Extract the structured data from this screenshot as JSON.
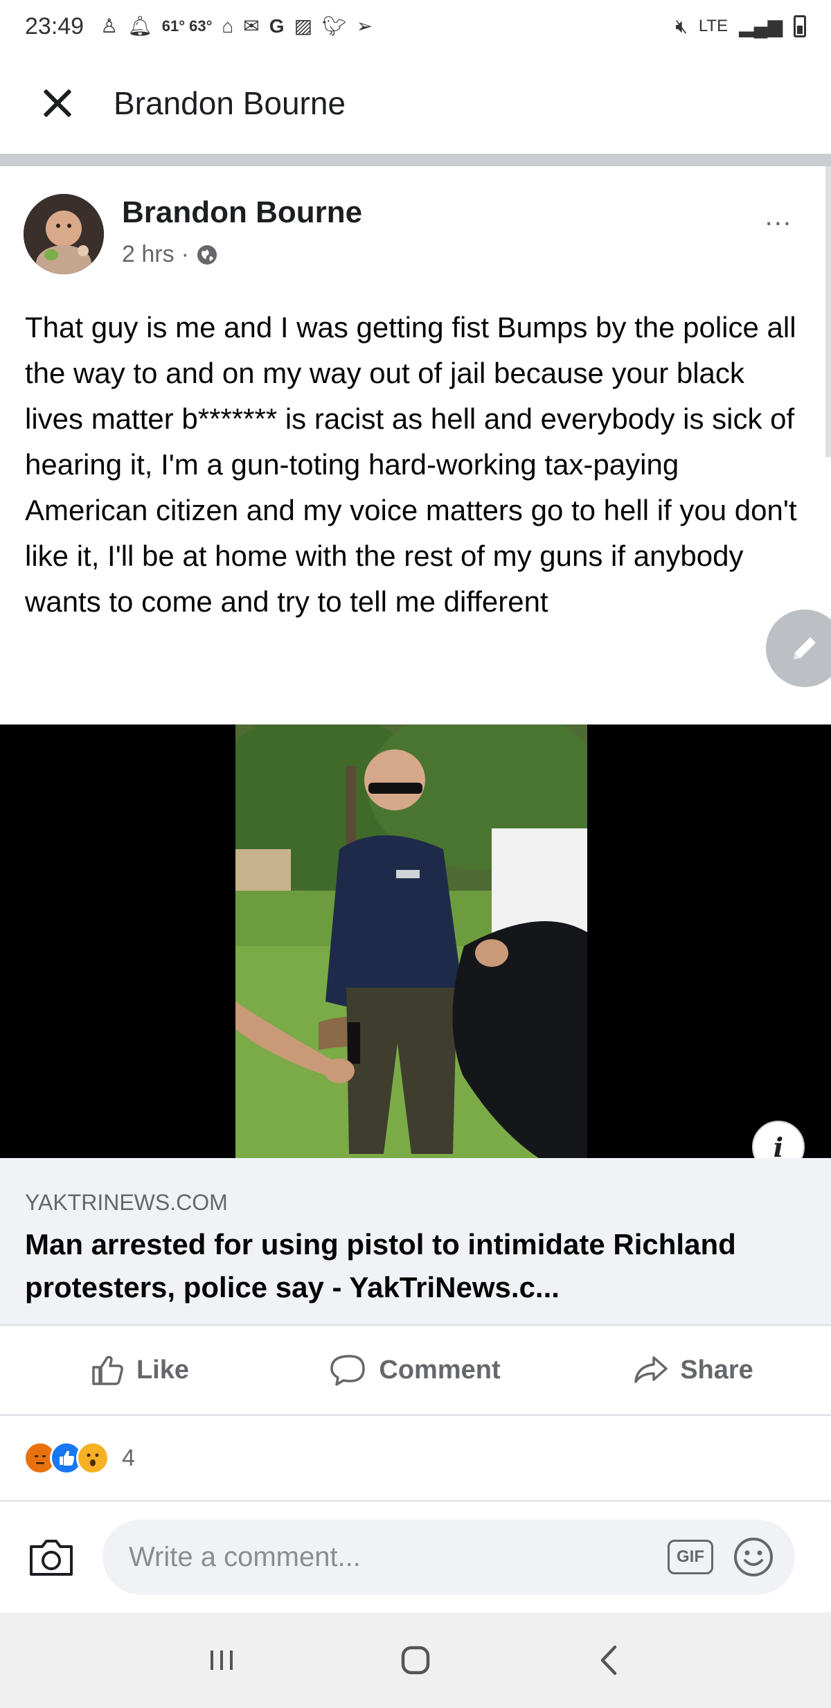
{
  "status_bar": {
    "time": "23:49",
    "temperature": "61° 63°",
    "network": "LTE"
  },
  "header": {
    "title": "Brandon Bourne"
  },
  "post": {
    "author": "Brandon Bourne",
    "time_ago": "2 hrs",
    "separator": "·",
    "text": "That guy is me and I was getting fist Bumps by the police all the way to and on my way out of jail because your black lives matter b******* is racist as hell and everybody is sick of hearing it, I'm a gun-toting hard-working tax-paying American citizen and my voice matters go to hell if you don't like it, I'll be at home with the rest of my guns if anybody wants to come and try to tell me different",
    "more_icon": "..."
  },
  "link_preview": {
    "domain": "YAKTRINEWS.COM",
    "title": "Man arrested for using pistol to intimidate Richland protesters, police say - YakTriNews.c..."
  },
  "actions": {
    "like_label": "Like",
    "comment_label": "Comment",
    "share_label": "Share"
  },
  "reactions": {
    "count": "4",
    "types": [
      "angry",
      "like",
      "wow"
    ]
  },
  "comment_box": {
    "placeholder": "Write a comment...",
    "gif_label": "GIF"
  },
  "colors": {
    "accent": "#1877f2",
    "secondary_text": "#65676b",
    "surface": "#f0f2f5"
  }
}
